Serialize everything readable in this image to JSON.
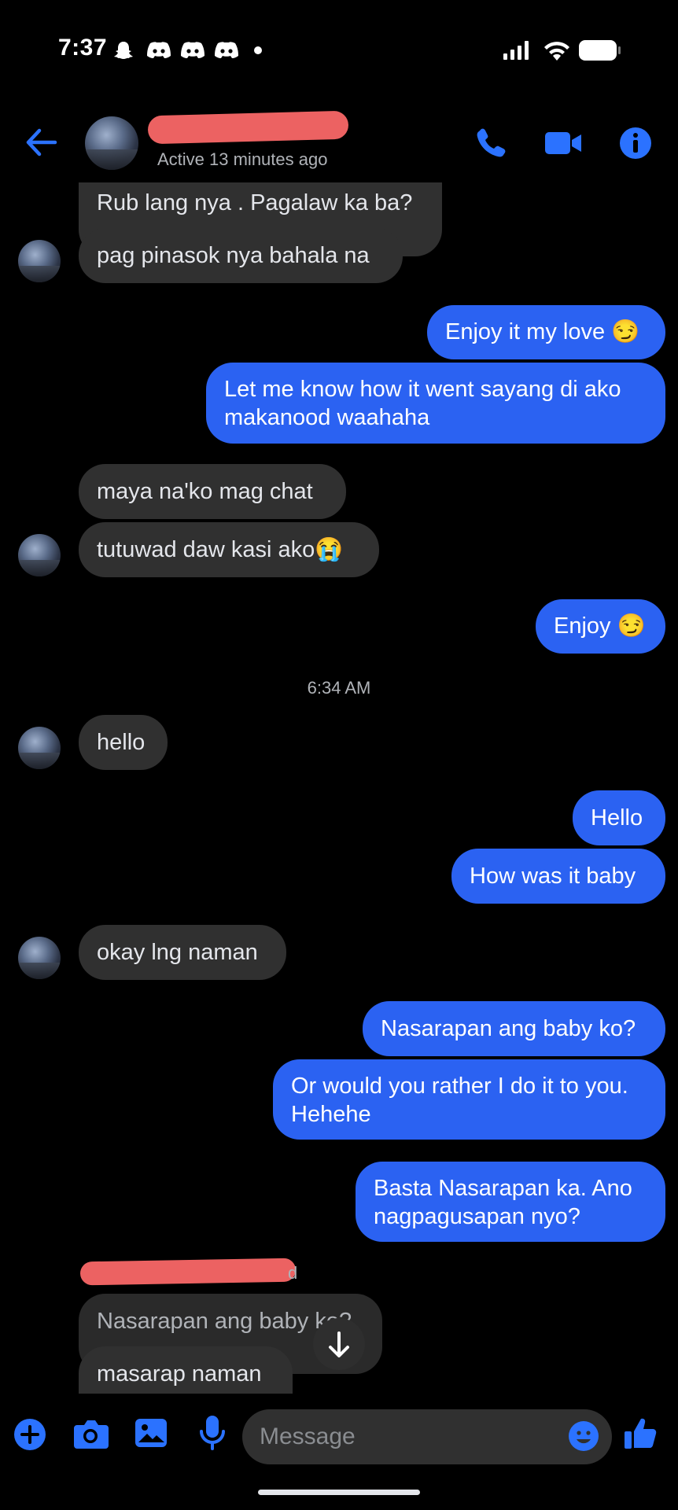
{
  "status_bar": {
    "time": "7:37",
    "left_icons": [
      "snapchat-icon",
      "discord-icon",
      "discord-icon",
      "discord-icon",
      "dot-icon"
    ],
    "right_icons": [
      "signal-icon",
      "wifi-icon",
      "battery-icon"
    ]
  },
  "header": {
    "back_icon": "back-arrow-icon",
    "status": "Active 13 minutes ago",
    "actions": [
      "phone-icon",
      "video-camera-icon",
      "info-icon"
    ]
  },
  "colors": {
    "accent": "#2b62f2",
    "incoming_bubble": "#303030",
    "redaction": "#ec6262"
  },
  "messages": [
    {
      "dir": "in",
      "lines": [
        "Rub lang nya . Pagalaw ka ba?"
      ]
    },
    {
      "dir": "in",
      "lines": [
        "pag pinasok nya bahala na"
      ]
    },
    {
      "dir": "out",
      "lines": [
        "Enjoy it my love 😏"
      ]
    },
    {
      "dir": "out",
      "lines": [
        "Let me know how it went sayang di ako",
        "makanood waahaha"
      ]
    },
    {
      "dir": "in",
      "lines": [
        "maya na'ko mag chat"
      ]
    },
    {
      "dir": "in",
      "lines": [
        "tutuwad daw kasi ako😭"
      ]
    },
    {
      "dir": "out",
      "lines": [
        "Enjoy 😏"
      ]
    },
    {
      "dir": "in",
      "lines": [
        "hello"
      ]
    },
    {
      "dir": "out",
      "lines": [
        "Hello"
      ]
    },
    {
      "dir": "out",
      "lines": [
        "How was it baby"
      ]
    },
    {
      "dir": "in",
      "lines": [
        "okay lng naman"
      ]
    },
    {
      "dir": "out",
      "lines": [
        "Nasarapan ang baby ko?"
      ]
    },
    {
      "dir": "out",
      "lines": [
        "Or would you rather I do it to you.",
        "Hehehe"
      ]
    },
    {
      "dir": "out",
      "lines": [
        "Basta Nasarapan ka. Ano",
        "nagpagusapan nyo?"
      ]
    },
    {
      "dir": "in",
      "lines": [
        "Nasarapan ang baby ko?"
      ],
      "quoted": true
    },
    {
      "dir": "in",
      "lines": [
        "masarap naman"
      ]
    }
  ],
  "timestamp": "6:34 AM",
  "reply_label_tail": "d",
  "composer": {
    "placeholder": "Message",
    "icons": [
      "plus-icon",
      "camera-icon",
      "gallery-icon",
      "microphone-icon",
      "emoji-icon",
      "thumbs-up-icon"
    ]
  }
}
